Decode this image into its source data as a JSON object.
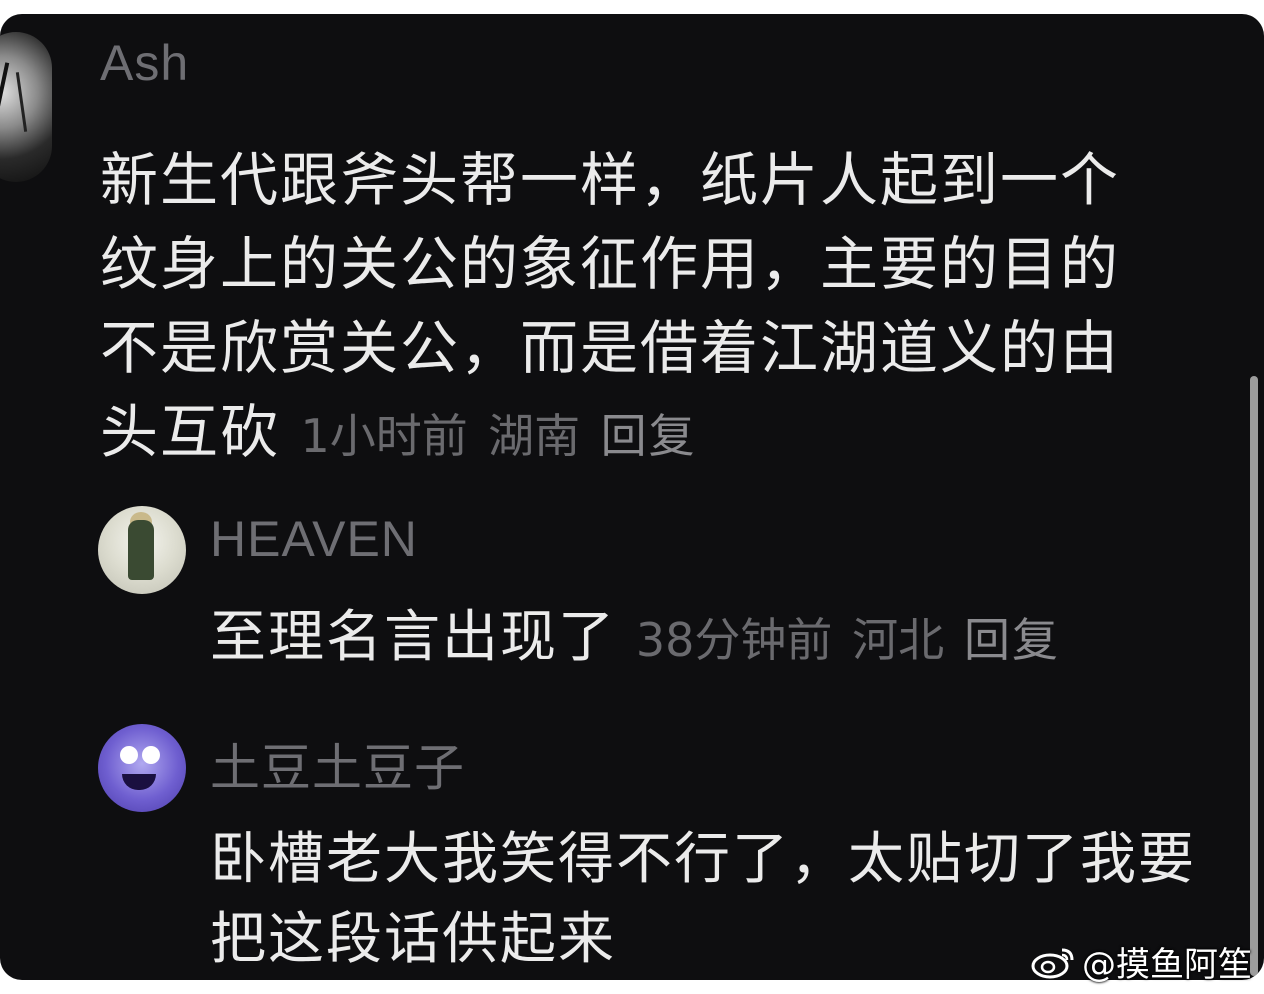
{
  "main_comment": {
    "username": "Ash",
    "text": "新生代跟斧头帮一样，纸片人起到一个纹身上的关公的象征作用，主要的目的不是欣赏关公，而是借着江湖道义的由头互砍",
    "time": "1小时前",
    "location": "湖南",
    "reply_label": "回复"
  },
  "replies": [
    {
      "username": "HEAVEN",
      "text": "至理名言出现了",
      "time": "38分钟前",
      "location": "河北",
      "reply_label": "回复"
    },
    {
      "username": "土豆土豆子",
      "text": "卧槽老大我笑得不行了，太贴切了我要把这段话供起来"
    }
  ],
  "watermark": {
    "text": "@摸鱼阿笙",
    "icon": "weibo-icon"
  }
}
